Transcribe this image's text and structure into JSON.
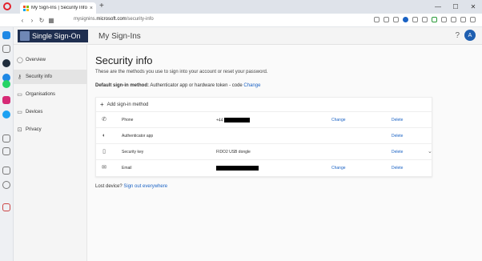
{
  "browser": {
    "tab_title": "My Sign-Ins | Security Info",
    "tab_close": "×",
    "new_tab": "+",
    "url_prefix": "mysignins.",
    "url_domain": "microsoft.com",
    "url_path": "/security-info",
    "min": "—",
    "max": "☐",
    "close": "✕",
    "nav_back": "‹",
    "nav_forward": "›",
    "nav_reload": "↻",
    "nav_tabs": "▦"
  },
  "header": {
    "brand": "Single Sign-On",
    "app_name": "My Sign-Ins",
    "help": "?",
    "avatar_initial": "A",
    "accent": "#1f2f50"
  },
  "nav": {
    "items": [
      {
        "label": "Overview",
        "icon": "person-icon"
      },
      {
        "label": "Security info",
        "icon": "key-icon",
        "active": true
      },
      {
        "label": "Organisations",
        "icon": "briefcase-icon"
      },
      {
        "label": "Devices",
        "icon": "laptop-icon"
      },
      {
        "label": "Privacy",
        "icon": "lock-icon"
      }
    ]
  },
  "main": {
    "title": "Security info",
    "description": "These are the methods you use to sign into your account or reset your password.",
    "default_label": "Default sign-in method:",
    "default_value": "Authenticator app or hardware token - code",
    "default_change": "Change",
    "add_method": "Add sign-in method",
    "methods": [
      {
        "name": "Phone",
        "icon": "phone-icon",
        "detail": "+44",
        "redacted": true,
        "change": "Change",
        "delete": "Delete"
      },
      {
        "name": "Authenticator app",
        "icon": "authenticator-icon",
        "detail": "",
        "change": "",
        "delete": "Delete"
      },
      {
        "name": "Security key",
        "icon": "usb-key-icon",
        "detail": "FIDO2 USB dongle",
        "change": "",
        "delete": "Delete",
        "expandable": true
      },
      {
        "name": "Email",
        "icon": "mail-icon",
        "detail": "",
        "redacted": true,
        "change": "Change",
        "delete": "Delete"
      }
    ],
    "lost_device": "Lost device?",
    "sign_out": "Sign out everywhere"
  }
}
